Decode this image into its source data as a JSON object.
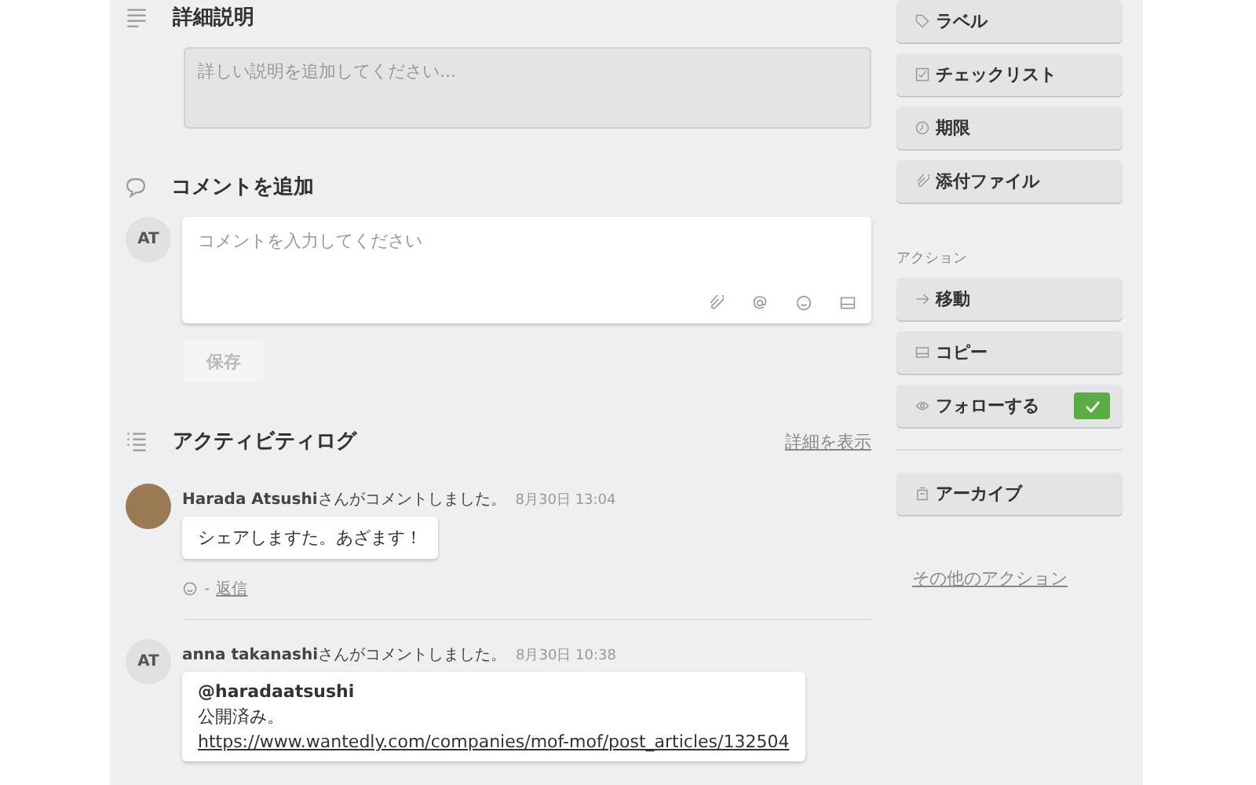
{
  "description": {
    "title": "詳細説明",
    "placeholder": "詳しい説明を追加してください..."
  },
  "comment": {
    "title": "コメントを追加",
    "avatar": "AT",
    "placeholder": "コメントを入力してください",
    "save": "保存"
  },
  "activity": {
    "title": "アクティビティログ",
    "details_link": "詳細を表示",
    "entries": [
      {
        "kind": "photo",
        "author": "Harada Atsushi",
        "action": "さんがコメントしました。",
        "time": "8月30日 13:04",
        "body": [
          {
            "kind": "text",
            "text": "シェアしますた。あざます！"
          }
        ],
        "reply_separator": "-",
        "reply": "返信"
      },
      {
        "kind": "initials",
        "initials": "AT",
        "author": "anna takanashi",
        "action": "さんがコメントしました。",
        "time": "8月30日 10:38",
        "body": [
          {
            "kind": "bold",
            "text": "@haradaatsushi"
          },
          {
            "kind": "text",
            "text": "公開済み。"
          },
          {
            "kind": "link",
            "text": "https://www.wantedly.com/companies/mof-mof/post_articles/132504"
          }
        ]
      }
    ]
  },
  "sidebar": {
    "add_buttons": [
      {
        "kind": "label",
        "label": "ラベル"
      },
      {
        "kind": "checklist",
        "label": "チェックリスト"
      },
      {
        "kind": "clock",
        "label": "期限"
      },
      {
        "kind": "clip",
        "label": "添付ファイル"
      }
    ],
    "actions_title": "アクション",
    "action_buttons": [
      {
        "kind": "move",
        "label": "移動"
      },
      {
        "kind": "copy",
        "label": "コピー"
      },
      {
        "kind": "follow",
        "label": "フォローする",
        "checked": true
      },
      {
        "kind": "archive",
        "label": "アーカイブ"
      }
    ],
    "more_link": "その他のアクション"
  }
}
